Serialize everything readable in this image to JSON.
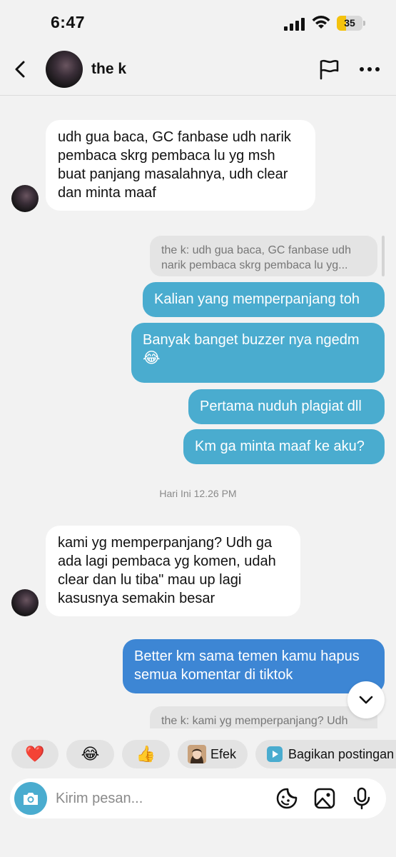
{
  "status_bar": {
    "time": "6:47",
    "battery": "35",
    "battery_level": 0.35,
    "battery_color": "#f4c20d"
  },
  "header": {
    "contact_name": "the k"
  },
  "messages": {
    "m1": "udh gua baca, GC fanbase udh narik pembaca skrg pembaca lu yg msh buat panjang masalahnya, udh clear dan minta maaf",
    "quote1": "the k: udh gua baca, GC fanbase udh narik pembaca skrg pembaca lu yg...",
    "m2": "Kalian yang memperpanjang toh",
    "m3": "Banyak banget buzzer nya ngedm",
    "m3_emoji": "😂",
    "m4": "Pertama nuduh plagiat dll",
    "m5": "Km ga minta maaf ke aku?",
    "date_separator": "Hari Ini 12.26 PM",
    "m6": "kami yg memperpanjang? Udh ga ada lagi pembaca yg komen, udah clear dan lu tiba\" mau up lagi kasusnya semakin besar",
    "m7": "Better km sama temen kamu hapus semua komentar di tiktok",
    "quote2": "the k: kami yg memperpanjang? Udh"
  },
  "quick_reactions": {
    "heart": "❤️",
    "laugh": "😂",
    "thumbs": "👍",
    "effects_label": "Efek",
    "share_label": "Bagikan postingan"
  },
  "composer": {
    "placeholder": "Kirim pesan..."
  },
  "colors": {
    "bubble_out_light": "#4aaccf",
    "bubble_out_dark": "#3d86d4",
    "bubble_in": "#ffffff",
    "camera": "#4aaccf"
  }
}
